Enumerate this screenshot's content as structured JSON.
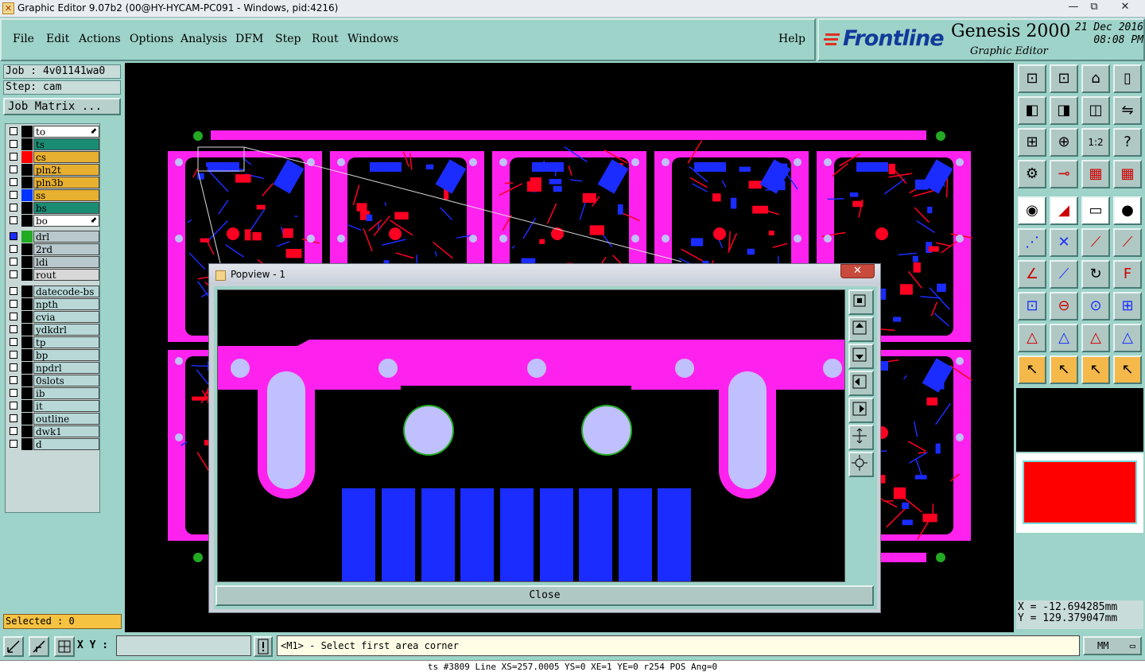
{
  "window": {
    "title": "Graphic Editor 9.07b2 (00@HY-HYCAM-PC091 - Windows, pid:4216)",
    "minimize": "—",
    "maximize": "⧉",
    "close": "✕"
  },
  "menu": [
    "File",
    "Edit",
    "Actions",
    "Options",
    "Analysis",
    "DFM",
    "Step",
    "Rout",
    "Windows"
  ],
  "help": "Help",
  "brand": {
    "logo": "Frontline",
    "product": "Genesis 2000",
    "subtitle": "Graphic Editor",
    "date": "21 Dec 2016",
    "time": "08:08 PM"
  },
  "job": {
    "job_label": "Job : 4v01141wa0",
    "step_label": "Step: cam",
    "matrix_button": "Job Matrix ..."
  },
  "layers": [
    {
      "name": "to",
      "color": "#ffffff",
      "swatch": "#000000",
      "arrow": true
    },
    {
      "name": "ts",
      "color": "#1a8c74",
      "swatch": "#000000"
    },
    {
      "name": "cs",
      "color": "#e8b030",
      "swatch": "#ff0000"
    },
    {
      "name": "pln2t",
      "color": "#e8b030",
      "swatch": "#000000"
    },
    {
      "name": "pln3b",
      "color": "#e8b030",
      "swatch": "#000000"
    },
    {
      "name": "ss",
      "color": "#e8b030",
      "swatch": "#0033ff"
    },
    {
      "name": "bs",
      "color": "#1a8c74",
      "swatch": "#000000"
    },
    {
      "name": "bo",
      "color": "#ffffff",
      "swatch": "#000000",
      "arrow": true
    },
    {
      "name": "drl",
      "color": "#b8c8cc",
      "swatch": "#22aa22",
      "active": true
    },
    {
      "name": "2rd",
      "color": "#b8c8cc",
      "swatch": "#000000"
    },
    {
      "name": "ldi",
      "color": "#b8c8cc",
      "swatch": "#000000"
    },
    {
      "name": "rout",
      "color": "#d8d8d8",
      "swatch": "#000000"
    },
    {
      "name": "datecode-bs",
      "color": "#b8d8d8",
      "swatch": "#000000"
    },
    {
      "name": "npth",
      "color": "#b8d8d8",
      "swatch": "#000000"
    },
    {
      "name": "cvia",
      "color": "#b8d8d8",
      "swatch": "#000000"
    },
    {
      "name": "ydkdrl",
      "color": "#b8d8d8",
      "swatch": "#000000"
    },
    {
      "name": "tp",
      "color": "#b8d8d8",
      "swatch": "#000000"
    },
    {
      "name": "bp",
      "color": "#b8d8d8",
      "swatch": "#000000"
    },
    {
      "name": "npdrl",
      "color": "#b8d8d8",
      "swatch": "#000000"
    },
    {
      "name": "0slots",
      "color": "#b8d8d8",
      "swatch": "#000000"
    },
    {
      "name": "ib",
      "color": "#b8d8d8",
      "swatch": "#000000"
    },
    {
      "name": "it",
      "color": "#b8d8d8",
      "swatch": "#000000"
    },
    {
      "name": "outline",
      "color": "#b8d8d8",
      "swatch": "#000000"
    },
    {
      "name": "dwk1",
      "color": "#b8d8d8",
      "swatch": "#000000"
    },
    {
      "name": "d",
      "color": "#b8d8d8",
      "swatch": "#000000"
    }
  ],
  "selected": "Selected : 0",
  "coords": {
    "x": "X = -12.694285mm",
    "y": "Y = 129.379047mm"
  },
  "statusbar": {
    "xy_label": "X Y :",
    "xy_value": "",
    "prompt": "<M1> - Select first area corner",
    "units": "MM"
  },
  "infobar": "ts #3809 Line XS=257.0005 YS=0 XE=1 YE=0 r254 POS Ang=0",
  "popview": {
    "title": "Popview - 1",
    "close_label": "Close",
    "close_x": "✕"
  },
  "colors": {
    "magenta": "#ff22ee",
    "red": "#ff0022",
    "blue": "#1a2cff",
    "lavender": "#c0c0ff"
  }
}
